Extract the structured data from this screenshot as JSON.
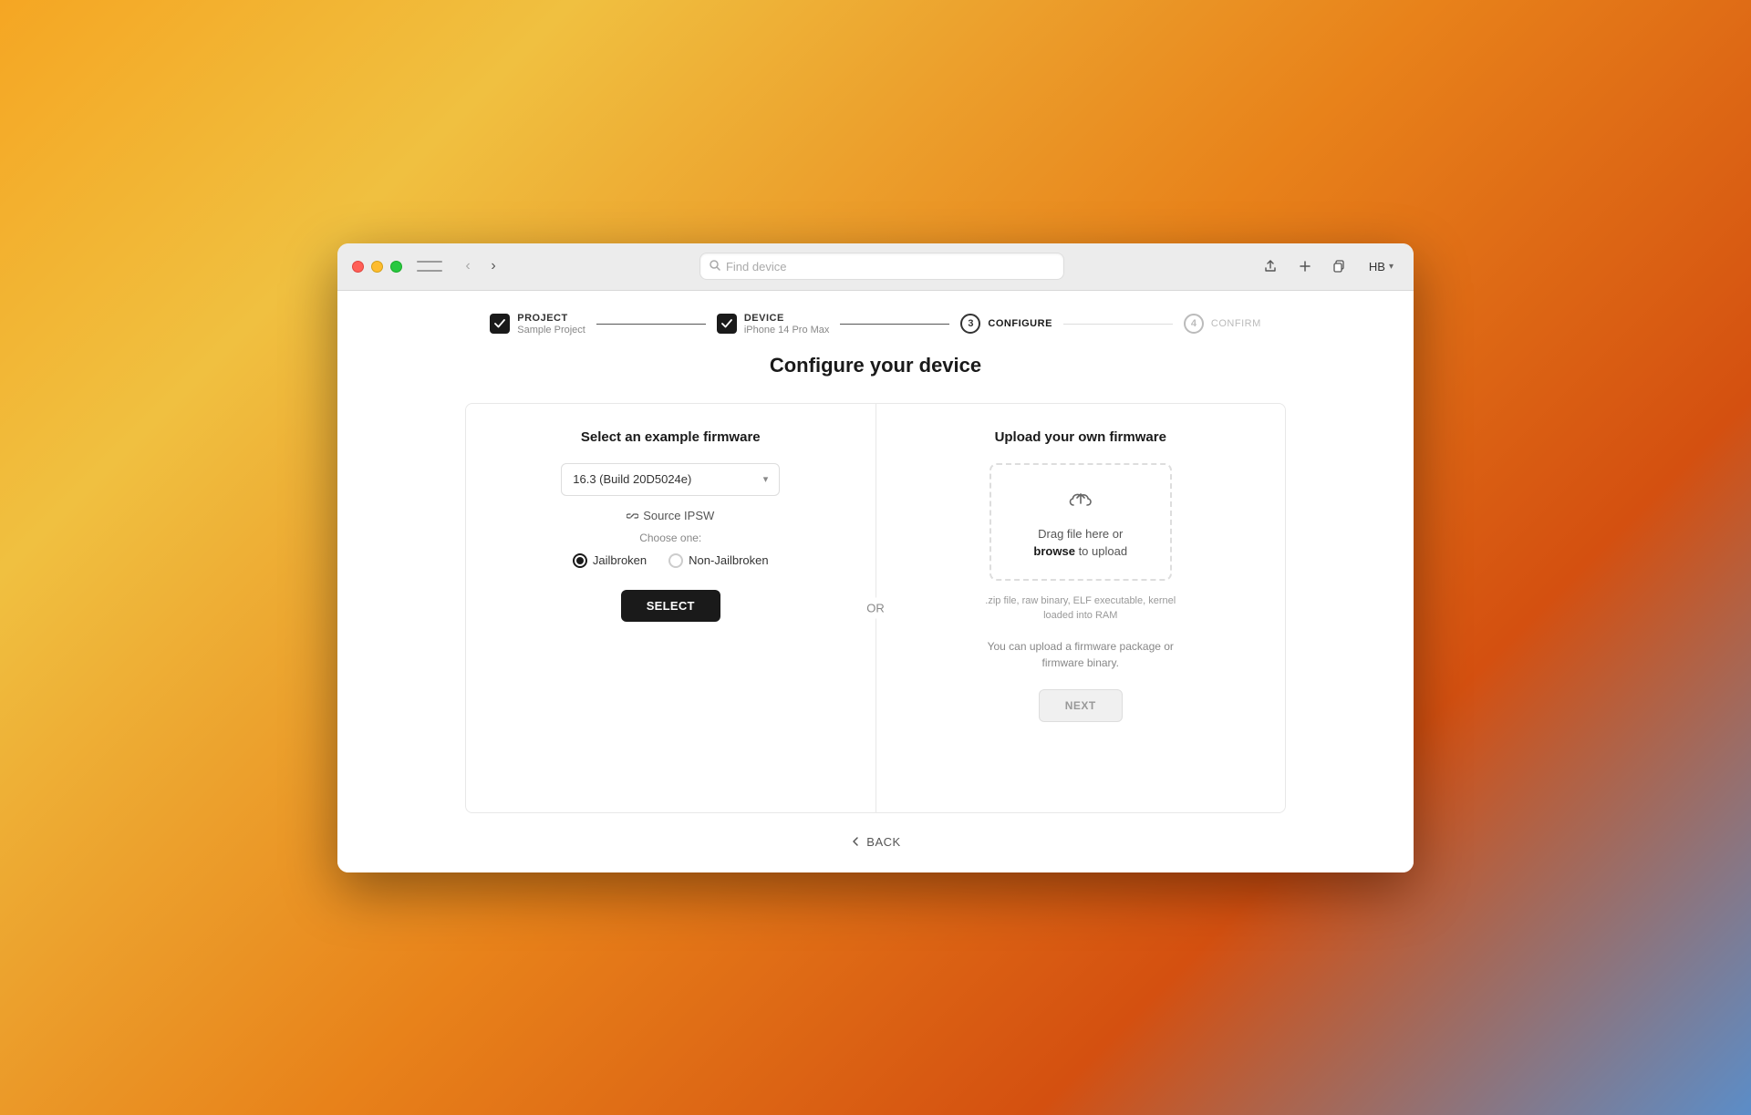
{
  "window": {
    "title": "Find device"
  },
  "titlebar": {
    "traffic_lights": [
      "red",
      "yellow",
      "green"
    ],
    "nav_back_label": "‹",
    "nav_forward_label": "›",
    "search_placeholder": "Find device",
    "actions": [
      "share",
      "add",
      "duplicate"
    ],
    "user_initials": "HB",
    "user_chevron": "▾"
  },
  "stepper": {
    "steps": [
      {
        "id": "project",
        "title": "PROJECT",
        "subtitle": "Sample Project",
        "state": "completed"
      },
      {
        "id": "device",
        "title": "DEVICE",
        "subtitle": "iPhone 14 Pro Max",
        "state": "completed"
      },
      {
        "id": "configure",
        "title": "CONFIGURE",
        "subtitle": "",
        "state": "active",
        "number": "3"
      },
      {
        "id": "confirm",
        "title": "CONFIRM",
        "subtitle": "",
        "state": "inactive",
        "number": "4"
      }
    ]
  },
  "page": {
    "title": "Configure your device"
  },
  "left_panel": {
    "title": "Select an example firmware",
    "dropdown_value": "16.3 (Build 20D5024e)",
    "dropdown_placeholder": "16.3 (Build 20D5024e)",
    "source_ipsw_label": "Source IPSW",
    "choose_label": "Choose one:",
    "radio_options": [
      {
        "id": "jailbroken",
        "label": "Jailbroken",
        "checked": true
      },
      {
        "id": "non-jailbroken",
        "label": "Non-Jailbroken",
        "checked": false
      }
    ],
    "select_button_label": "SELECT"
  },
  "or_label": "OR",
  "right_panel": {
    "title": "Upload your own firmware",
    "upload_drag_text_1": "Drag file here or",
    "upload_drag_text_2": "browse",
    "upload_drag_text_3": "to upload",
    "upload_hint": ".zip file, raw binary, ELF executable, kernel loaded into RAM",
    "upload_info": "You can upload a firmware package or firmware binary.",
    "next_button_label": "NEXT"
  },
  "back_button_label": "BACK",
  "colors": {
    "accent": "#1a1a1a",
    "border": "#e8e8e8",
    "text_muted": "#888",
    "bg": "#ffffff"
  }
}
